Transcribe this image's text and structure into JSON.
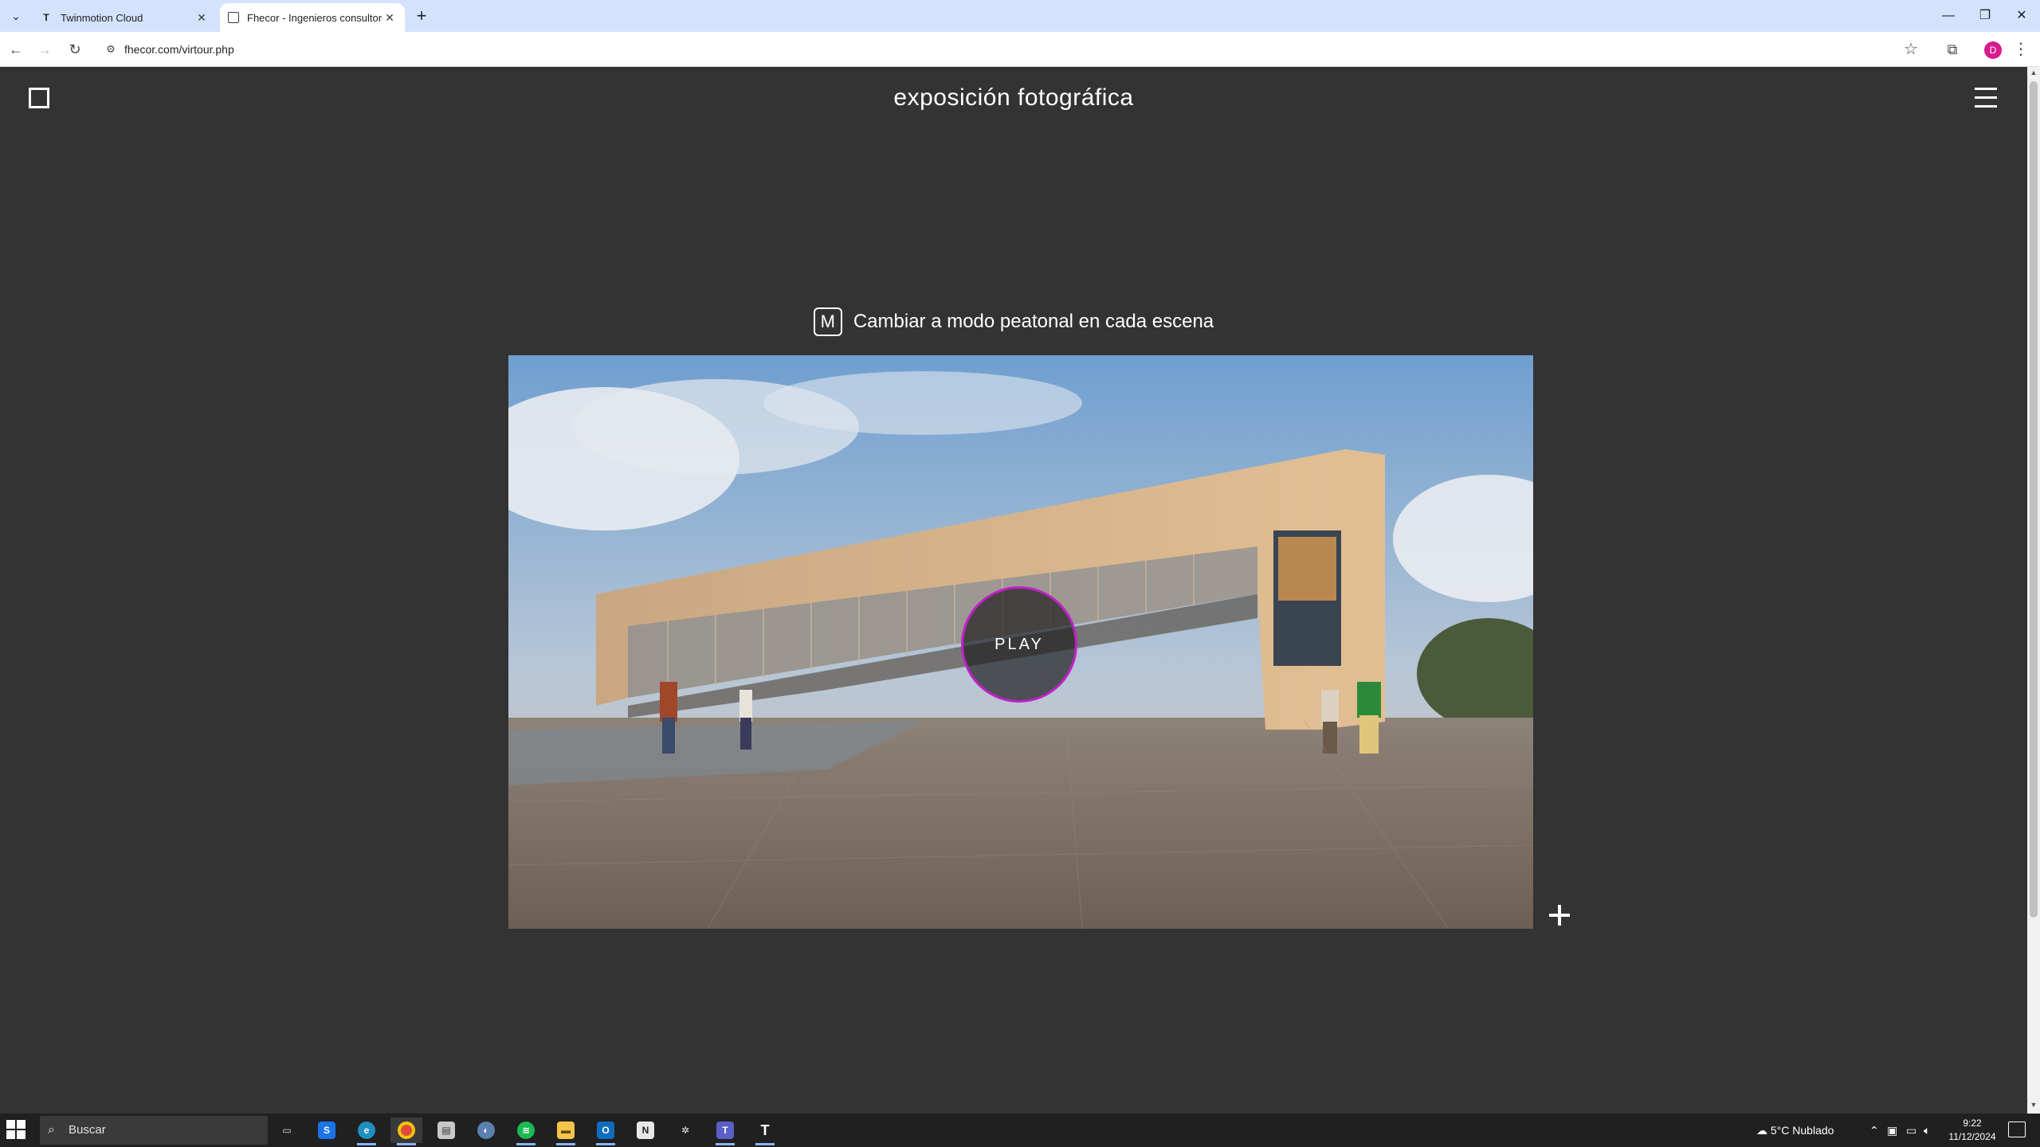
{
  "browser": {
    "tabs": [
      {
        "title": "Twinmotion Cloud",
        "favicon": "twinmotion-logo",
        "active": false
      },
      {
        "title": "Fhecor - Ingenieros consultores",
        "favicon": "page-square-icon",
        "active": true
      }
    ],
    "url": "fhecor.com/virtour.php",
    "profile_initial": "D"
  },
  "page": {
    "title": "exposición fotográfica",
    "mode_key": "M",
    "mode_hint": "Cambiar a modo peatonal en cada escena",
    "play_label": "PLAY"
  },
  "taskbar": {
    "search_placeholder": "Buscar",
    "weather": "5°C  Nublado",
    "time": "9:22",
    "date": "11/12/2024"
  },
  "colors": {
    "page_bg": "#333333",
    "play_ring": "#c020c8",
    "tab_strip": "#d3e3fd",
    "taskbar": "#202020"
  }
}
